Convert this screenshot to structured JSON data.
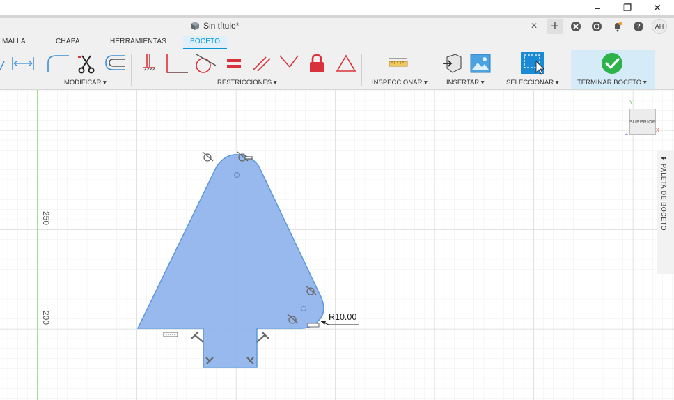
{
  "window": {
    "minimize_icon": "minimize-icon",
    "restore_icon": "restore-icon",
    "close_icon": "close-icon",
    "minimize_glyph": "–",
    "restore_glyph": "❐",
    "close_glyph": "✕"
  },
  "document": {
    "title": "Sin título*",
    "close_glyph": "×",
    "add_glyph": "+"
  },
  "user": {
    "initials": "AH"
  },
  "workspace_tabs": {
    "malla": "MALLA",
    "chapa": "CHAPA",
    "herramientas": "HERRAMIENTAS",
    "boceto": "BOCETO"
  },
  "toolbar_groups": {
    "modificar": "MODIFICAR ▾",
    "restricciones": "RESTRICCIONES ▾",
    "inspeccionar": "INSPECCIONAR ▾",
    "insertar": "INSERTAR ▾",
    "seleccionar": "SELECCIONAR ▾",
    "terminar": "TERMINAR BOCETO ▾"
  },
  "canvas": {
    "ruler_250": "250",
    "ruler_200": "200",
    "dimension": "R10.00"
  },
  "viewcube": {
    "face": "SUPERIOR",
    "x": "X",
    "y": "Y",
    "z": "Z"
  },
  "palette": {
    "label": "PALETA DE BOCETO",
    "collapse_glyph": "◂◂"
  },
  "colors": {
    "accent": "#0696d7",
    "sketch_fill": "#8fb3ec",
    "sketch_stroke": "#5b97dd",
    "constraint_red": "#d9323a",
    "finish_green": "#2eb24a",
    "axis_green": "#7fd36b"
  }
}
